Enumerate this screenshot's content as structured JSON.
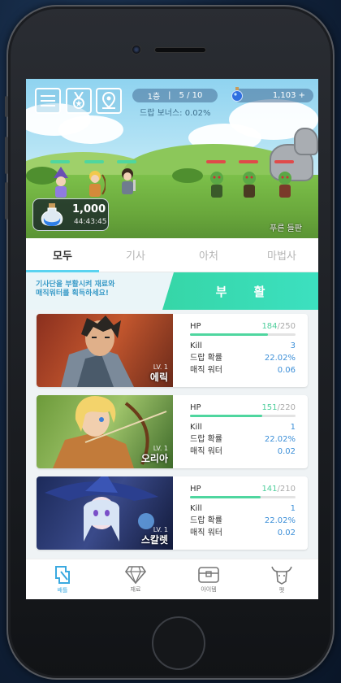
{
  "hud": {
    "floor": "1층",
    "wave": "5 / 10",
    "drop_bonus": "드랍 보너스: 0.02%",
    "magic_water": "1,103 +"
  },
  "potion": {
    "amount": "1,000",
    "timer": "44:43:45"
  },
  "stage": {
    "name": "푸른 들판"
  },
  "tabs": [
    {
      "label": "모두",
      "active": true
    },
    {
      "label": "기사",
      "active": false
    },
    {
      "label": "아처",
      "active": false
    },
    {
      "label": "마법사",
      "active": false
    }
  ],
  "revive": {
    "message_line1": "기사단을 부활시켜 재료와",
    "message_line2": "매직워터를 획득하세요!",
    "button_label": "부 활"
  },
  "heroes": [
    {
      "name": "에릭",
      "level": "LV. 1",
      "hp_current": "184",
      "hp_max": "/250",
      "hp_fraction": 0.736,
      "hp_label": "HP",
      "kill_label": "Kill",
      "kill": "3",
      "drop_label": "드랍 확률",
      "drop_rate": "22.02%",
      "water_label": "매직 워터",
      "magic_water": "0.06"
    },
    {
      "name": "오리아",
      "level": "LV. 1",
      "hp_current": "151",
      "hp_max": "/220",
      "hp_fraction": 0.686,
      "hp_label": "HP",
      "kill_label": "Kill",
      "kill": "1",
      "drop_label": "드랍 확률",
      "drop_rate": "22.02%",
      "water_label": "매직 워터",
      "magic_water": "0.02"
    },
    {
      "name": "스칼렛",
      "level": "LV. 1",
      "hp_current": "141",
      "hp_max": "/210",
      "hp_fraction": 0.671,
      "hp_label": "HP",
      "kill_label": "Kill",
      "kill": "1",
      "drop_label": "드랍 확률",
      "drop_rate": "22.02%",
      "water_label": "매직 워터",
      "magic_water": "0.02"
    }
  ],
  "nav": [
    {
      "label": "배틀",
      "icon": "battle-icon",
      "active": true
    },
    {
      "label": "재료",
      "icon": "gem-icon",
      "active": false
    },
    {
      "label": "아이템",
      "icon": "chest-icon",
      "active": false
    },
    {
      "label": "펫",
      "icon": "pet-icon",
      "active": false
    }
  ],
  "colors": {
    "accent": "#5ad3f0",
    "revive": "#36d6a7",
    "hp_fill": "#4fd69f",
    "value_blue": "#3c8fd8"
  }
}
